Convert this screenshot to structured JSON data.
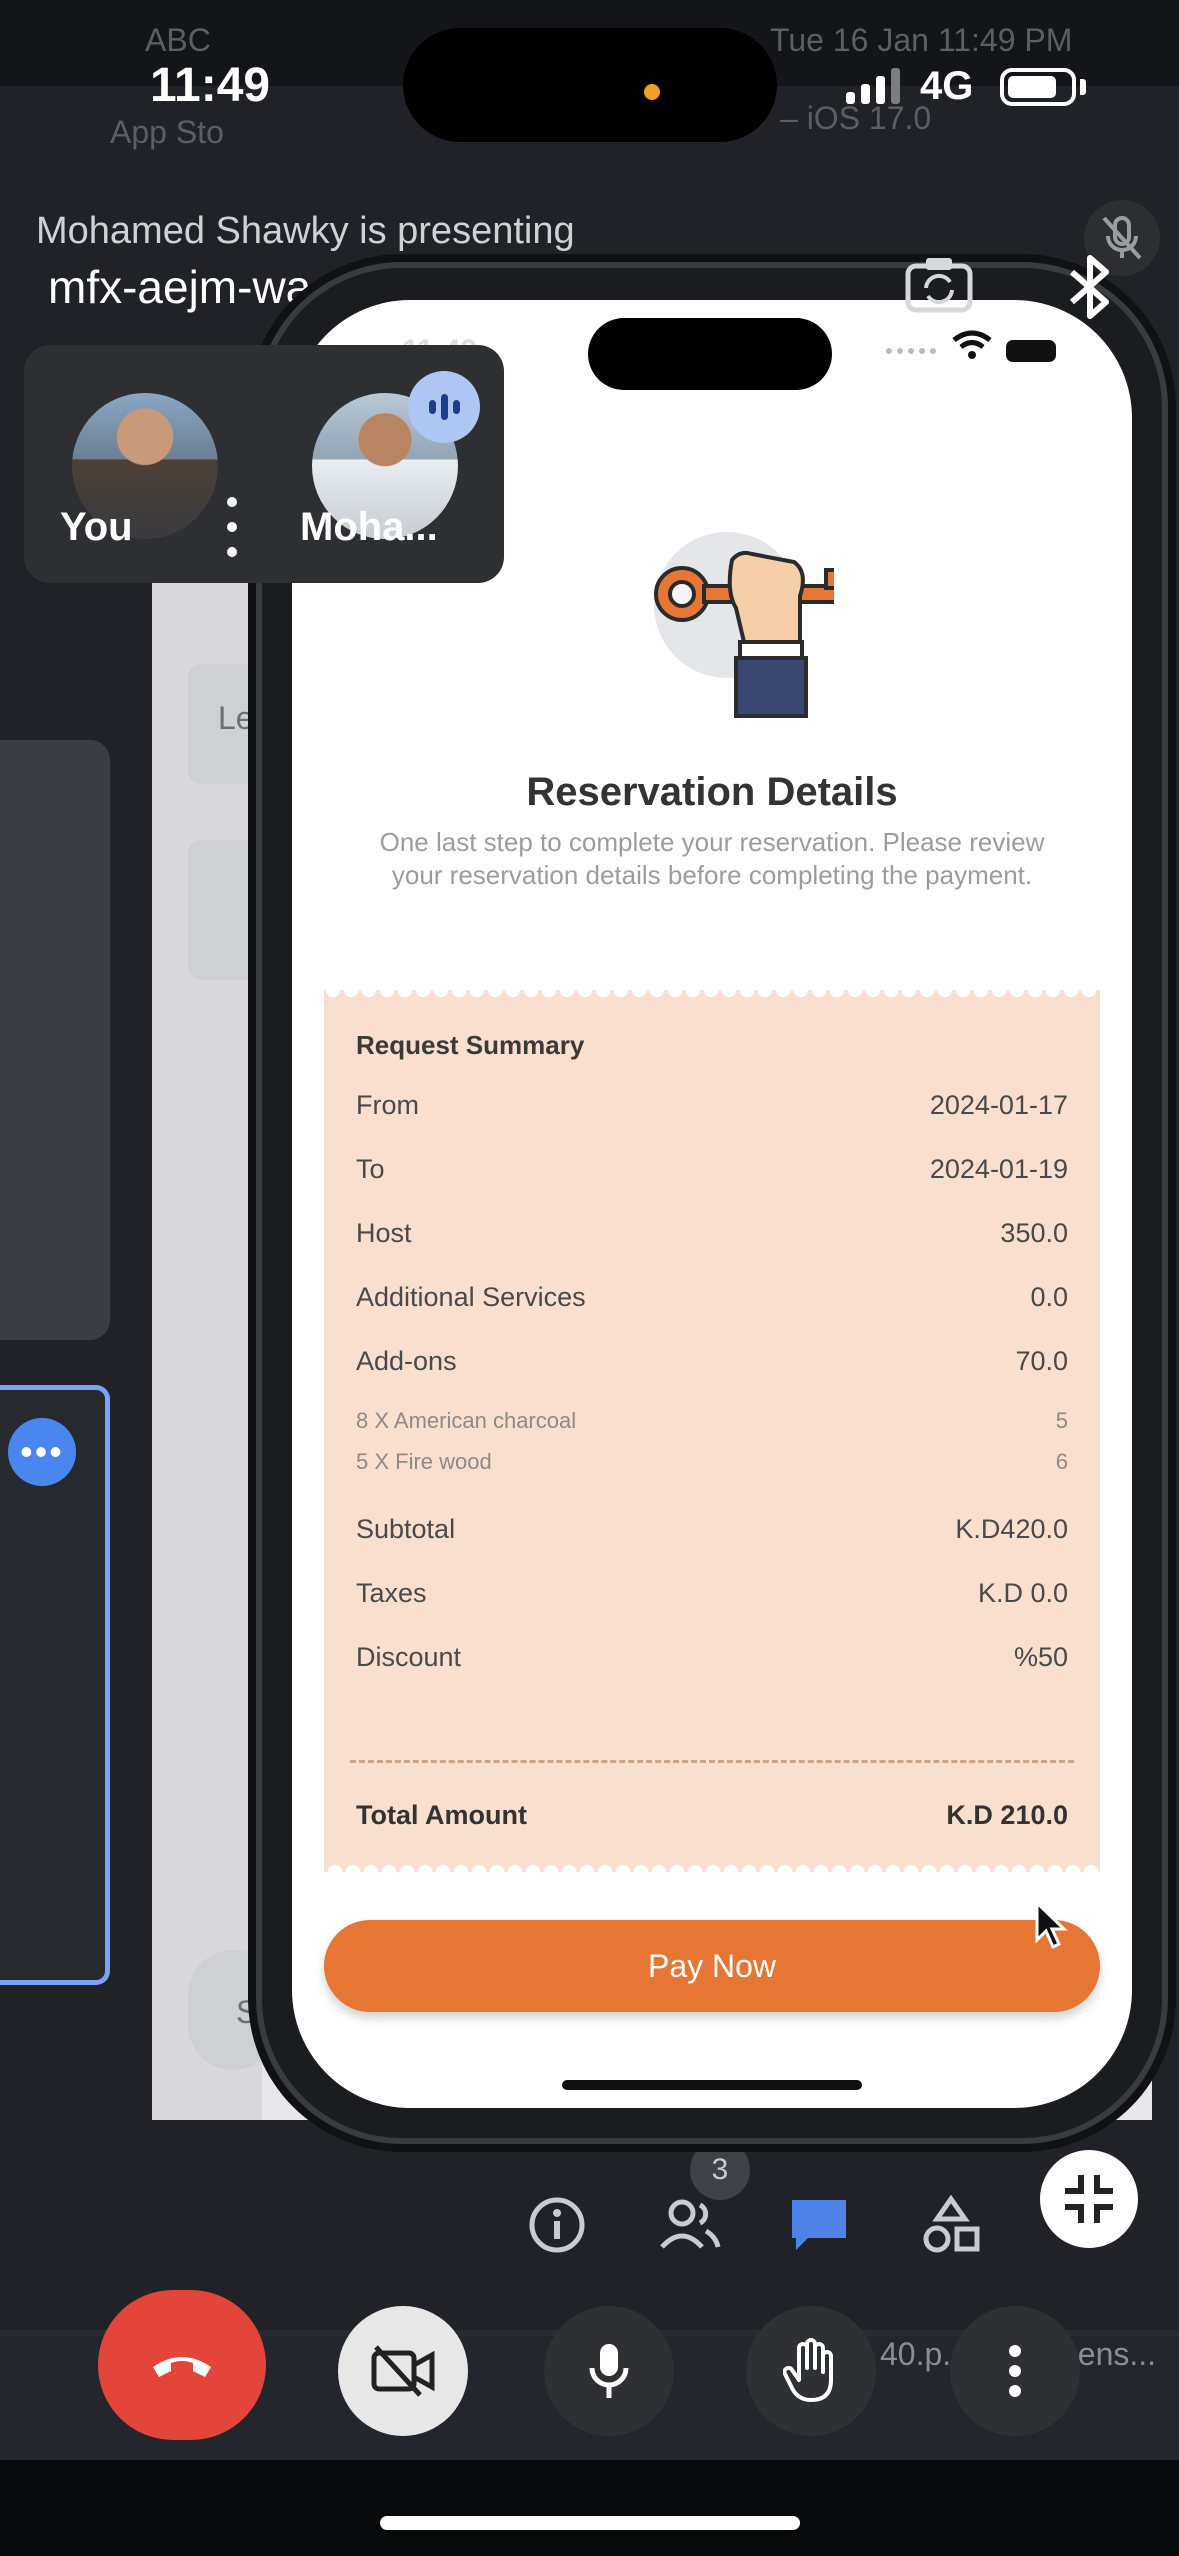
{
  "status_bar": {
    "time": "11:49",
    "network": "4G"
  },
  "meet": {
    "presenting_text": "Mohamed Shawky is presenting",
    "meeting_code": "mfx-aejm-wao",
    "participants": [
      {
        "name": "You"
      },
      {
        "name": "Moha..."
      }
    ],
    "people_count": "3"
  },
  "background": {
    "menubar_left": "ABC",
    "menubar_right": "Tue 16 Jan  11:49 PM",
    "app_store": "App Sto",
    "window_title": "– iOS 17.0",
    "dock_text": "40.p...",
    "dock_text2": "eens...",
    "editor_hint": "Le",
    "editor_hint2": "S"
  },
  "app": {
    "phone_time": "11:49",
    "title": "Reservation Details",
    "subtitle": "One last step to complete your reservation. Please review your reservation details before completing the payment.",
    "summary_heading": "Request Summary",
    "rows": [
      {
        "label": "From",
        "value": "2024-01-17"
      },
      {
        "label": "To",
        "value": "2024-01-19"
      },
      {
        "label": "Host",
        "value": "350.0"
      },
      {
        "label": "Additional Services",
        "value": "0.0"
      },
      {
        "label": "Add-ons",
        "value": "70.0"
      }
    ],
    "addon_items": [
      {
        "label": "8 X American charcoal",
        "value": "5"
      },
      {
        "label": "5 X Fire wood",
        "value": "6"
      }
    ],
    "totals": [
      {
        "label": "Subtotal",
        "value": "K.D420.0"
      },
      {
        "label": "Taxes",
        "value": "K.D 0.0"
      },
      {
        "label": "Discount",
        "value": "%50"
      }
    ],
    "total_label": "Total Amount",
    "total_value": "K.D 210.0",
    "pay_button": "Pay Now"
  },
  "colors": {
    "accent": "#e57634",
    "receipt_bg": "#f8dfd0",
    "end_call": "#e4453b"
  }
}
